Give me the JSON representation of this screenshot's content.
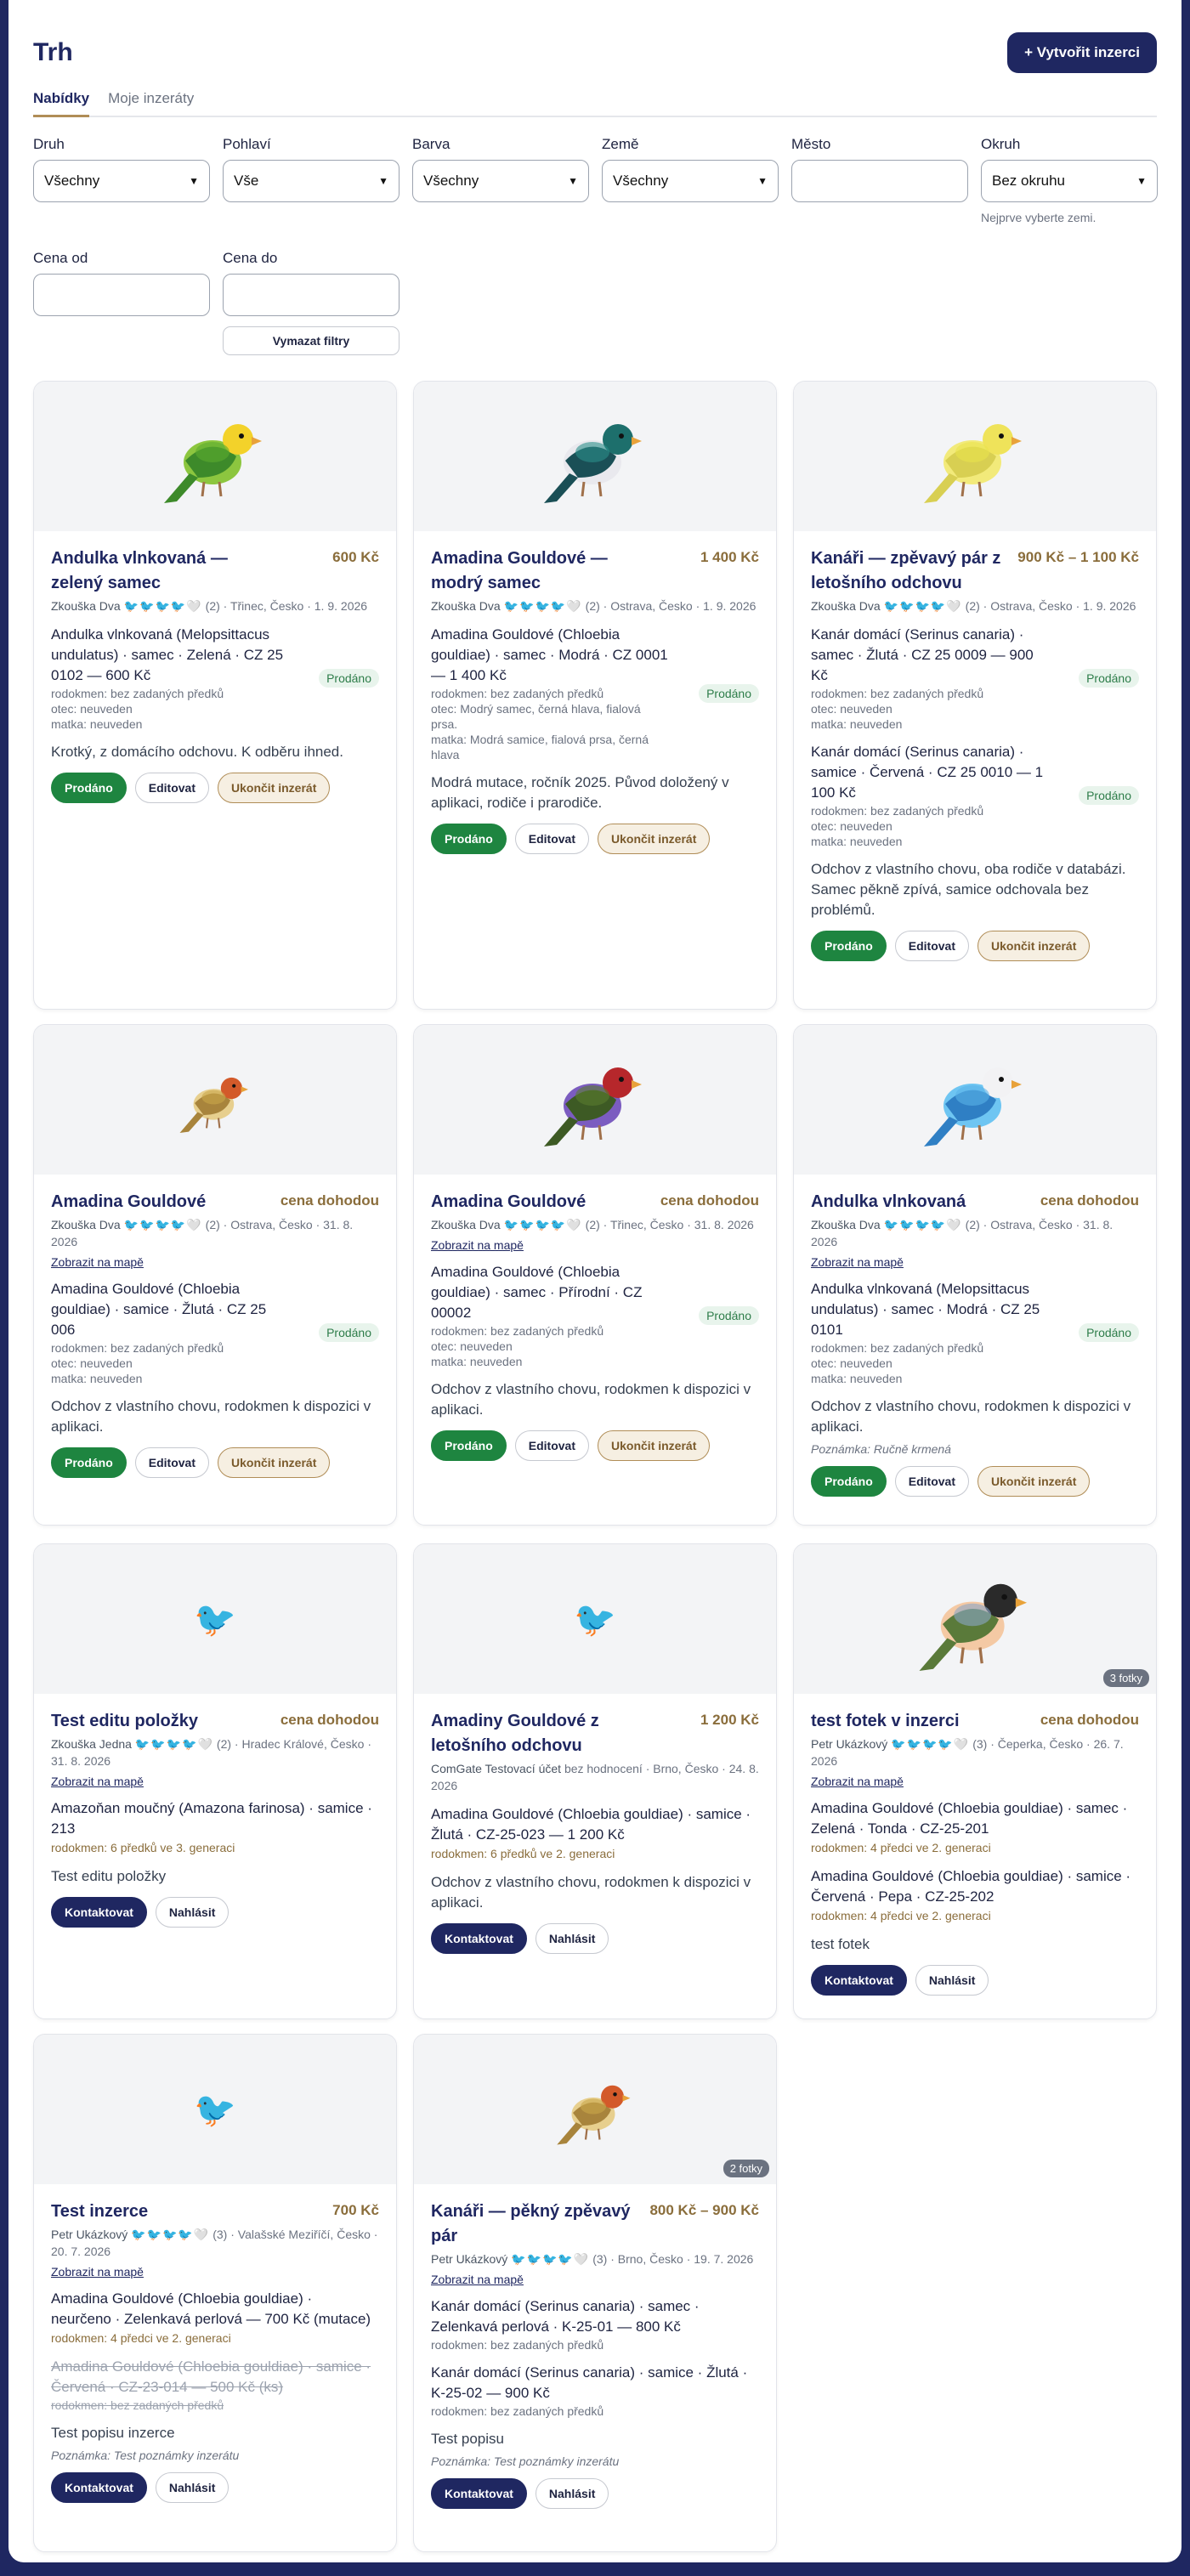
{
  "header": {
    "title": "Trh",
    "create_label": "+ Vytvořit inzerci"
  },
  "tabs": [
    {
      "label": "Nabídky"
    },
    {
      "label": "Moje inzeráty"
    }
  ],
  "filters": {
    "druh": {
      "label": "Druh",
      "value": "Všechny"
    },
    "pohlavi": {
      "label": "Pohlaví",
      "value": "Vše"
    },
    "barva": {
      "label": "Barva",
      "value": "Všechny"
    },
    "zeme": {
      "label": "Země",
      "value": "Všechny"
    },
    "mesto": {
      "label": "Město",
      "value": ""
    },
    "okruh": {
      "label": "Okruh",
      "value": "Bez okruhu",
      "hint": "Nejprve vyberte zemi."
    },
    "cena_od": {
      "label": "Cena od",
      "value": ""
    },
    "cena_do": {
      "label": "Cena do",
      "value": ""
    },
    "clear_label": "Vymazat filtry"
  },
  "labels": {
    "sold": "Prodáno",
    "edit": "Editovat",
    "end": "Ukončit inzerát",
    "contact": "Kontaktovat",
    "report": "Nahlásit",
    "map": "Zobrazit na mapě"
  },
  "cards": [
    {
      "title": "Andulka vlnkovaná — zelený samec",
      "price": "600 Kč",
      "seller": "Zkouška Dva",
      "rating": "(2)",
      "place_date": "· Třinec, Česko · 1. 9. 2026",
      "items": [
        {
          "text": "Andulka vlnkovaná (Melopsittacus undulatus) · samec · Zelená · CZ 25 0102 — 600 Kč",
          "l1": "rodokmen: bez zadaných předků",
          "l2": "otec: neuveden",
          "l3": "matka: neuveden"
        }
      ],
      "desc": "Krotký, z domácího odchovu. K odběru ihned."
    },
    {
      "title": "Amadina Gouldové — modrý samec",
      "price": "1 400 Kč",
      "seller": "Zkouška Dva",
      "rating": "(2)",
      "place_date": "· Ostrava, Česko · 1. 9. 2026",
      "items": [
        {
          "text": "Amadina Gouldové (Chloebia gouldiae) · samec · Modrá · CZ 0001 — 1 400 Kč",
          "l1": "rodokmen: bez zadaných předků",
          "l2": "otec: Modrý samec, černá hlava, fialová prsa.",
          "l3": "matka: Modrá samice, fialová prsa, černá hlava"
        }
      ],
      "desc": "Modrá mutace, ročník 2025. Původ doložený v aplikaci, rodiče i prarodiče."
    },
    {
      "title": "Kanáři — zpěvavý pár z letošního odchovu",
      "price": "900 Kč – 1 100 Kč",
      "seller": "Zkouška Dva",
      "rating": "(2)",
      "place_date": "· Ostrava, Česko · 1. 9. 2026",
      "items": [
        {
          "text": "Kanár domácí (Serinus canaria) · samec · Žlutá · CZ 25 0009 — 900 Kč",
          "l1": "rodokmen: bez zadaných předků",
          "l2": "otec: neuveden",
          "l3": "matka: neuveden"
        },
        {
          "text": "Kanár domácí (Serinus canaria) · samice · Červená · CZ 25 0010 — 1 100 Kč",
          "l1": "rodokmen: bez zadaných předků",
          "l2": "otec: neuveden",
          "l3": "matka: neuveden"
        }
      ],
      "desc": "Odchov z vlastního chovu, oba rodiče v databázi. Samec pěkně zpívá, samice odchovala bez problémů."
    },
    {
      "title": "Amadina Gouldové",
      "price": "cena dohodou",
      "seller": "Zkouška Dva",
      "rating": "(2)",
      "place_date": "· Ostrava, Česko · 31. 8. 2026",
      "items": [
        {
          "text": "Amadina Gouldové (Chloebia gouldiae) · samice · Žlutá · CZ 25 006",
          "l1": "rodokmen: bez zadaných předků",
          "l2": "otec: neuveden",
          "l3": "matka: neuveden"
        }
      ],
      "desc": "Odchov z vlastního chovu, rodokmen k dispozici v aplikaci."
    },
    {
      "title": "Amadina Gouldové",
      "price": "cena dohodou",
      "seller": "Zkouška Dva",
      "rating": "(2)",
      "place_date": "· Třinec, Česko · 31. 8. 2026",
      "items": [
        {
          "text": "Amadina Gouldové (Chloebia gouldiae) · samec · Přírodní · CZ 00002",
          "l1": "rodokmen: bez zadaných předků",
          "l2": "otec: neuveden",
          "l3": "matka: neuveden"
        }
      ],
      "desc": "Odchov z vlastního chovu, rodokmen k dispozici v aplikaci."
    },
    {
      "title": "Andulka vlnkovaná",
      "price": "cena dohodou",
      "seller": "Zkouška Dva",
      "rating": "(2)",
      "place_date": "· Ostrava, Česko · 31. 8. 2026",
      "items": [
        {
          "text": "Andulka vlnkovaná (Melopsittacus undulatus) · samec · Modrá · CZ 25 0101",
          "l1": "rodokmen: bez zadaných předků",
          "l2": "otec: neuveden",
          "l3": "matka: neuveden"
        }
      ],
      "desc": "Odchov z vlastního chovu, rodokmen k dispozici v aplikaci.",
      "note": "Poznámka: Ručně krmená"
    },
    {
      "title": "Test editu položky",
      "price": "cena dohodou",
      "seller": "Zkouška Jedna",
      "rating": "(2)",
      "place_date": "· Hradec Králové, Česko · 31. 8. 2026",
      "items": [
        {
          "text": "Amazoňan moučný (Amazona farinosa) · samice · 213",
          "gold": "rodokmen: 6 předků ve 3. generaci"
        }
      ],
      "desc": "Test editu položky"
    },
    {
      "title": "Amadiny Gouldové z letošního odchovu",
      "price": "1 200 Kč",
      "seller": "ComGate Testovací účet",
      "rating": "bez hodnocení",
      "place_date": "· Brno, Česko · 24. 8. 2026",
      "items": [
        {
          "text": "Amadina Gouldové (Chloebia gouldiae) · samice · Žlutá · CZ-25-023 — 1 200 Kč",
          "gold": "rodokmen: 6 předků ve 2. generaci"
        }
      ],
      "desc": "Odchov z vlastního chovu, rodokmen k dispozici v aplikaci."
    },
    {
      "title": "test fotek v inzerci",
      "price": "cena dohodou",
      "seller": "Petr Ukázkový",
      "rating": "(3)",
      "place_date": "· Čeperka, Česko · 26. 7. 2026",
      "photos": "3 fotky",
      "items": [
        {
          "text": "Amadina Gouldové (Chloebia gouldiae) · samec · Zelená · Tonda · CZ-25-201",
          "gold": "rodokmen: 4 předci ve 2. generaci"
        },
        {
          "text": "Amadina Gouldové (Chloebia gouldiae) · samice · Červená · Pepa · CZ-25-202",
          "gold": "rodokmen: 4 předci ve 2. generaci"
        }
      ],
      "desc": "test fotek"
    },
    {
      "title": "Test inzerce",
      "price": "700 Kč",
      "seller": "Petr Ukázkový",
      "rating": "(3)",
      "place_date": "· Valašské Meziříčí, Česko · 20. 7. 2026",
      "items": [
        {
          "text": "Amadina Gouldové (Chloebia gouldiae) · neurčeno · Zelenkavá perlová — 700 Kč (mutace)",
          "gold": "rodokmen: 4 předci ve 2. generaci"
        },
        {
          "text": "Amadina Gouldové (Chloebia gouldiae) · samice · Červená · CZ-23-014 — 500 Kč (ks)",
          "sm": "rodokmen: bez zadaných předků",
          "struck": true
        }
      ],
      "desc": "Test popisu inzerce",
      "note": "Poznámka: Test poznámky inzerátu"
    },
    {
      "title": "Kanáři — pěkný zpěvavý pár",
      "price": "800 Kč – 900 Kč",
      "seller": "Petr Ukázkový",
      "rating": "(3)",
      "place_date": "· Brno, Česko · 19. 7. 2026",
      "photos": "2 fotky",
      "items": [
        {
          "text": "Kanár domácí (Serinus canaria) · samec · Zelenkavá perlová · K-25-01 — 800 Kč",
          "sm": "rodokmen: bez zadaných předků"
        },
        {
          "text": "Kanár domácí (Serinus canaria) · samice · Žlutá · K-25-02 — 900 Kč",
          "sm": "rodokmen: bez zadaných předků"
        }
      ],
      "desc": "Test popisu",
      "note": "Poznámka: Test poznámky inzerátu"
    }
  ]
}
